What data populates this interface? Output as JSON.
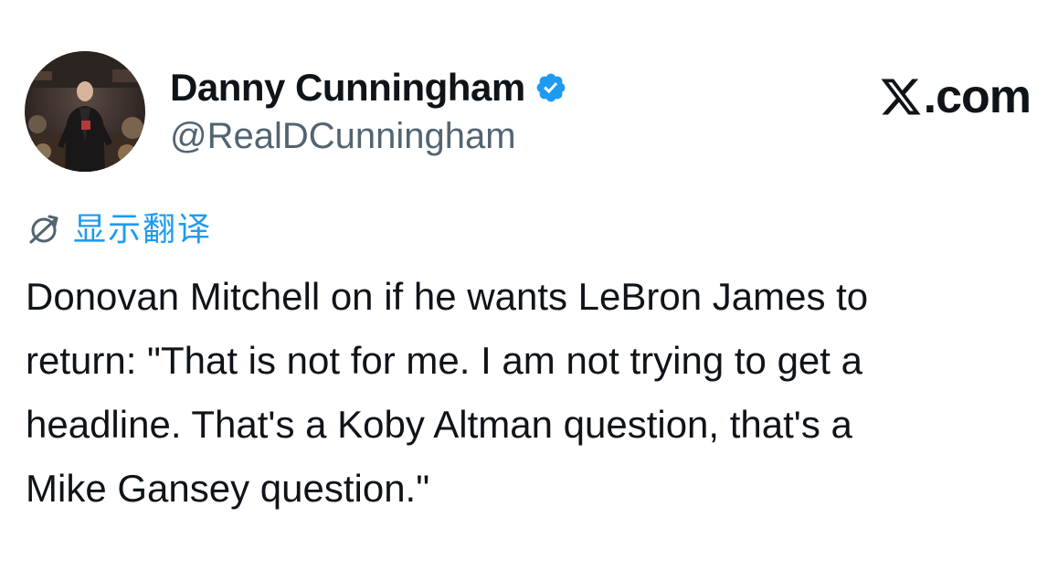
{
  "author": {
    "display_name": "Danny Cunningham",
    "handle": "@RealDCunningham",
    "verified": true,
    "avatar_icon": "avatar-photo",
    "verified_icon": "verified-badge-icon"
  },
  "brand": {
    "text": ".com",
    "logo_icon": "x-logo-icon"
  },
  "translate": {
    "label": "显示翻译",
    "icon": "globe-icon"
  },
  "tweet": {
    "lines": [
      "Donovan Mitchell on if he wants LeBron James to",
      "return: \"That is not for me. I am not trying to get a",
      "headline. That's a Koby Altman question, that's a",
      "Mike Gansey question.\""
    ]
  },
  "colors": {
    "text_primary": "#0f1419",
    "text_secondary": "#536471",
    "accent_blue": "#1d9bf0"
  }
}
